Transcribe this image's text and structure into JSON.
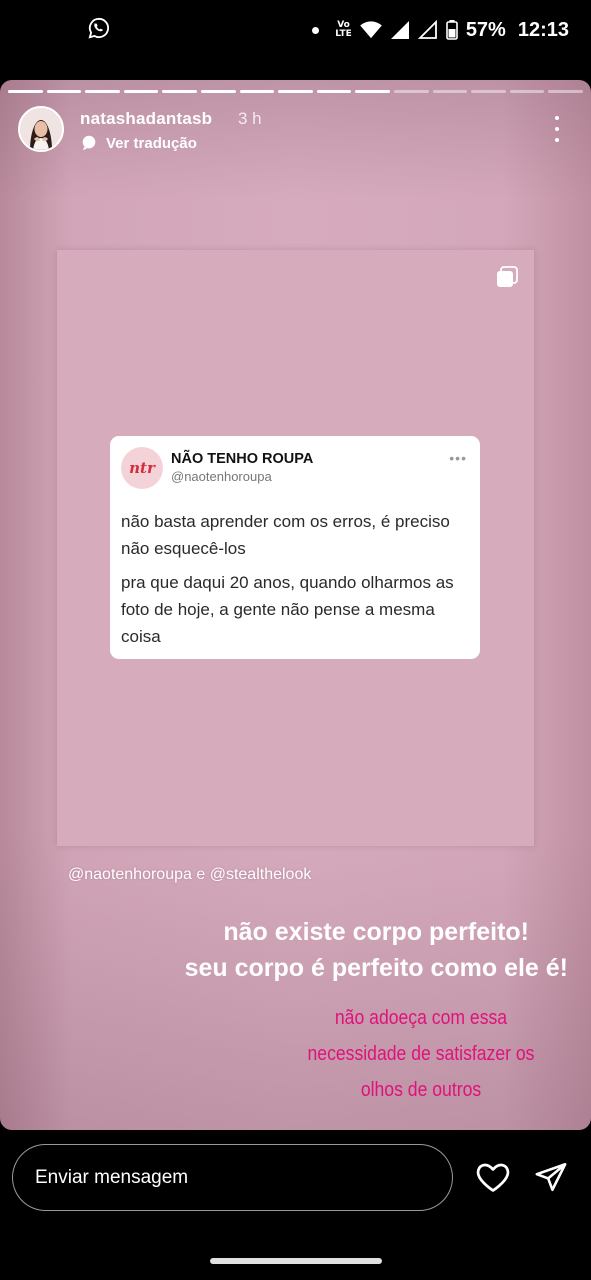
{
  "status_bar": {
    "battery": "57%",
    "time": "12:13",
    "volte_top": "Vo",
    "volte_bottom": "LTE",
    "icons": [
      "whatsapp-icon",
      "dot-icon",
      "volte-icon",
      "wifi-icon",
      "signal-icon",
      "signal-empty-icon",
      "battery-icon"
    ]
  },
  "story": {
    "progress_total": 15,
    "progress_done": 10,
    "username": "natashadantasb",
    "time_ago": "3 h",
    "translate_label": "Ver tradução",
    "post": {
      "tweet": {
        "name": "NÃO TENHO ROUPA",
        "handle": "@naotenhoroupa",
        "avatar_text": "ntr",
        "more": "•••",
        "paragraph1": "não basta aprender com os erros, é preciso não esquecê-los",
        "paragraph2": "pra que daqui 20 anos, quando olharmos as foto de hoje, a gente não pense a mesma coisa"
      }
    },
    "mentions": {
      "first": "@naotenhoroupa",
      "joiner": "e",
      "second": "@stealthelook"
    },
    "caption_line1": "não existe corpo perfeito!",
    "caption_line2": "seu corpo é perfeito como ele é!",
    "caption_pink": "não adoeça com essa necessidade de satisfazer os olhos de outros"
  },
  "reply": {
    "placeholder": "Enviar mensagem"
  },
  "colors": {
    "story_bg": "#d6abbd",
    "pink_text": "#e0127a",
    "brand_red": "#d42e3c"
  }
}
